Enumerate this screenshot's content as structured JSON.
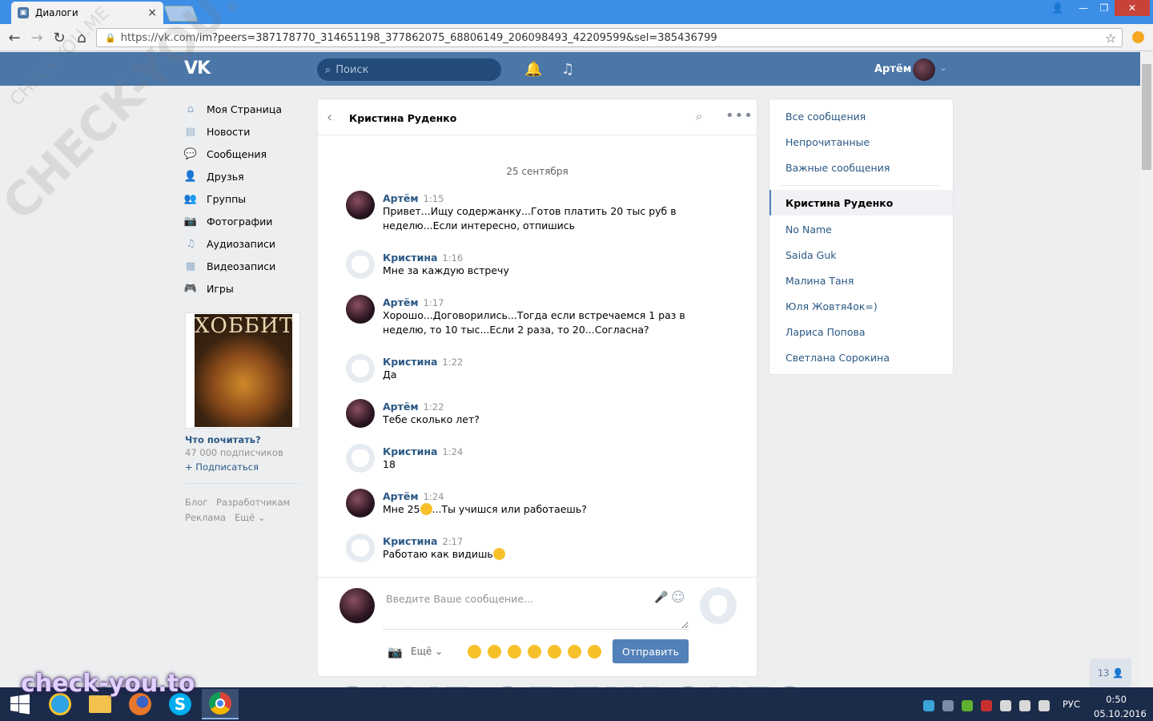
{
  "browser": {
    "tab_title": "Диалоги",
    "tab_close": "×",
    "url_host": "https://vk.com/",
    "url_path": "im?peers=387178770_314651198_377862075_68806149_206098493_42209599&sel=385436799",
    "window_controls": {
      "user": "👤",
      "minimize": "—",
      "restore": "❐",
      "close": "✕"
    },
    "nav": {
      "back": "←",
      "forward": "→",
      "reload": "↻",
      "home": "⌂",
      "star": "☆",
      "lock": "🔒"
    }
  },
  "header": {
    "logo": "VK",
    "search_placeholder": "Поиск",
    "search_icon": "search-icon",
    "bell_icon": "🔔",
    "music_icon": "♫",
    "user_name": "Артём",
    "chevron": "⌄"
  },
  "left_menu": {
    "items": [
      {
        "label": "Моя Страница",
        "icon": "⌂"
      },
      {
        "label": "Новости",
        "icon": "▤"
      },
      {
        "label": "Сообщения",
        "icon": "💬"
      },
      {
        "label": "Друзья",
        "icon": "👤"
      },
      {
        "label": "Группы",
        "icon": "👥"
      },
      {
        "label": "Фотографии",
        "icon": "📷"
      },
      {
        "label": "Аудиозаписи",
        "icon": "♫"
      },
      {
        "label": "Видеозаписи",
        "icon": "▦"
      },
      {
        "label": "Игры",
        "icon": "🎮"
      }
    ],
    "ad": {
      "poster_title": "ХОББИТ",
      "title": "Что почитать?",
      "subscribers": "47 000 подписчиков",
      "subscribe": "+ Подписаться"
    },
    "footer": {
      "blog": "Блог",
      "developers": "Разработчикам",
      "ads": "Реклама",
      "more": "Ещё ⌄"
    }
  },
  "dialog": {
    "back": "‹",
    "title": "Кристина Руденко",
    "search": "⌕",
    "more": "•••",
    "date": "25 сентября",
    "messages": [
      {
        "author": "Артём",
        "time": "1:15",
        "text": "Привет...Ищу содержанку...Готов платить 20 тыс руб в неделю...Если интересно, отпишись"
      },
      {
        "author": "Кристина",
        "time": "1:16",
        "text": "Мне за каждую встречу"
      },
      {
        "author": "Артём",
        "time": "1:17",
        "text": "Хорошо...Договорились...Тогда если встречаемся 1 раз в неделю, то 10 тыс...Если 2 раза, то 20...Согласна?"
      },
      {
        "author": "Кристина",
        "time": "1:22",
        "text": "Да"
      },
      {
        "author": "Артём",
        "time": "1:22",
        "text": "Тебе сколько лет?"
      },
      {
        "author": "Кристина",
        "time": "1:24",
        "text": "18"
      },
      {
        "author": "Артём",
        "time": "1:24",
        "text_before": "Мне 25",
        "text_after": "...Ты учишся или работаешь?"
      },
      {
        "author": "Кристина",
        "time": "2:17",
        "text_before": "Работаю как видишь",
        "text_after": ""
      }
    ],
    "composer": {
      "placeholder": "Введите Ваше сообщение...",
      "mic": "🎤",
      "smile": "☺",
      "camera": "📷",
      "more": "Ещё ⌄",
      "send": "Отправить",
      "emoji_count": 7
    }
  },
  "right_panel": {
    "filters": [
      "Все сообщения",
      "Непрочитанные",
      "Важные сообщения"
    ],
    "active_dialog": "Кристина Руденко",
    "dialogs": [
      "No Name",
      "Saida Guk",
      "Малина Таня",
      "Юля Жовтя4ок=)",
      "Лариса Попова",
      "Светлана Сорокина"
    ]
  },
  "friends_online": "13 👤",
  "banner_text": "GAME OF THRONES",
  "taskbar": {
    "lang": "РУС",
    "time": "0:50",
    "date": "05.10.2016"
  },
  "watermarks": {
    "diagonal_big": "CHECK-YOU.ME",
    "diagonal_small": "CHECK-YOU.ME",
    "bottom": "check-you.to"
  },
  "colors": {
    "vk_blue": "#4a76a8",
    "link": "#2a5885",
    "send_button": "#5181b8",
    "chrome_titlebar": "#3c8ee6",
    "taskbar": "#1b2b4a"
  }
}
